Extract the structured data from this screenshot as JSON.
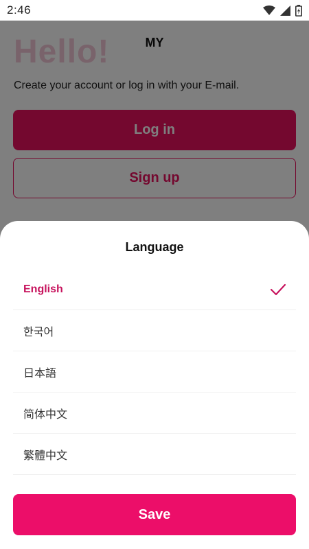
{
  "status_bar": {
    "time": "2:46",
    "icons": [
      "wifi-icon",
      "signal-icon",
      "battery-icon"
    ]
  },
  "header": {
    "title": "MY"
  },
  "main": {
    "greeting": "Hello!",
    "subtitle": "Create your account or log in with your E-mail.",
    "login_label": "Log in",
    "signup_label": "Sign up"
  },
  "language_sheet": {
    "title": "Language",
    "options": [
      {
        "label": "English",
        "selected": true
      },
      {
        "label": "한국어",
        "selected": false
      },
      {
        "label": "日本語",
        "selected": false
      },
      {
        "label": "简体中文",
        "selected": false
      },
      {
        "label": "繁體中文",
        "selected": false
      }
    ],
    "save_label": "Save"
  },
  "colors": {
    "accent": "#ec0e69",
    "selected_text": "#c7135d",
    "overlay": "rgba(0,0,0,0.5)"
  }
}
